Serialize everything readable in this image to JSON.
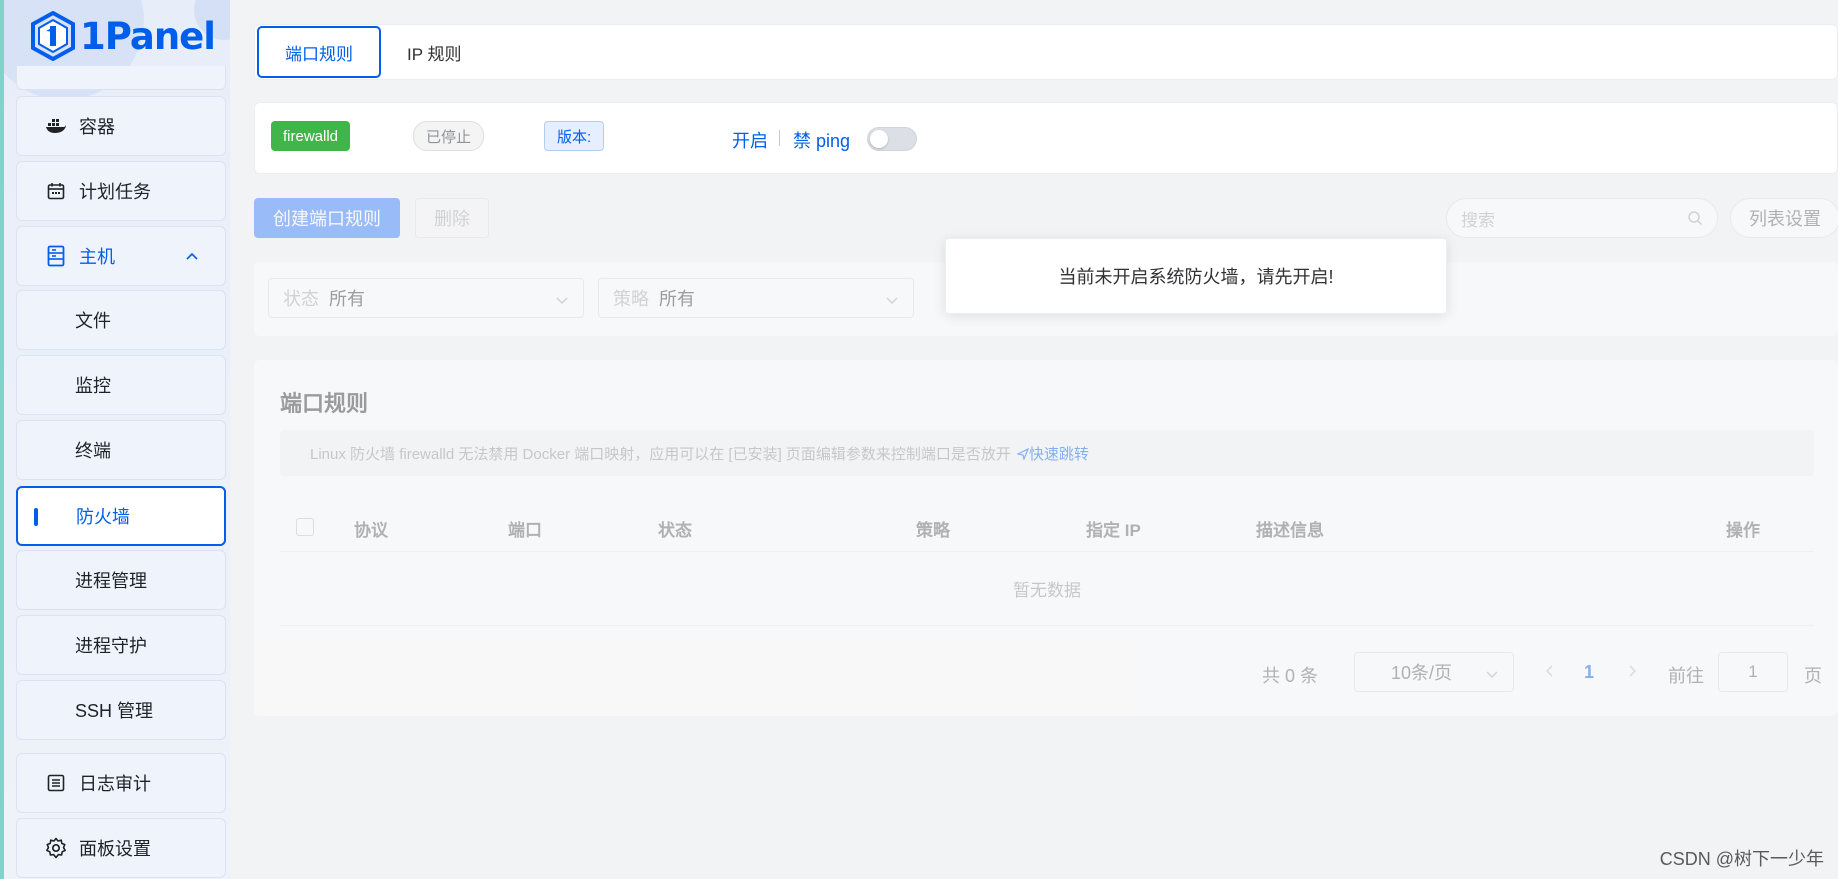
{
  "app": {
    "logo_text": "1Panel"
  },
  "sidebar": {
    "items": [
      {
        "label": "容器",
        "icon": "docker-icon"
      },
      {
        "label": "计划任务",
        "icon": "calendar-icon"
      },
      {
        "label": "主机",
        "icon": "host-icon",
        "expanded": true
      },
      {
        "label": "文件"
      },
      {
        "label": "监控"
      },
      {
        "label": "终端"
      },
      {
        "label": "防火墙",
        "active": true
      },
      {
        "label": "进程管理"
      },
      {
        "label": "进程守护"
      },
      {
        "label": "SSH 管理"
      },
      {
        "label": "日志审计",
        "icon": "list-icon"
      },
      {
        "label": "面板设置",
        "icon": "gear-icon"
      }
    ]
  },
  "tabs": [
    {
      "label": "端口规则",
      "active": true
    },
    {
      "label": "IP 规则"
    }
  ],
  "status": {
    "service_tag": "firewalld",
    "state_tag": "已停止",
    "version_tag": "版本:",
    "start_link": "开启",
    "ping_link": "禁 ping",
    "ping_disabled": false
  },
  "toolbar": {
    "create_label": "创建端口规则",
    "delete_label": "删除",
    "search_placeholder": "搜索",
    "list_settings_label": "列表设置"
  },
  "filters": {
    "status_label": "状态",
    "status_value": "所有",
    "strategy_label": "策略",
    "strategy_value": "所有"
  },
  "table": {
    "title": "端口规则",
    "alert_text": "Linux 防火墙 firewalld 无法禁用 Docker 端口映射，应用可以在 [已安装] 页面编辑参数来控制端口是否放开",
    "alert_link": "快速跳转",
    "columns": [
      "协议",
      "端口",
      "状态",
      "策略",
      "指定 IP",
      "描述信息",
      "操作"
    ],
    "empty_text": "暂无数据"
  },
  "pagination": {
    "total": "共 0 条",
    "page_size": "10条/页",
    "current_page": "1",
    "goto_label": "前往",
    "goto_value": "1",
    "goto_suffix": "页"
  },
  "toast": {
    "message": "当前未开启系统防火墙，请先开启!"
  },
  "watermark": "CSDN @树下一少年",
  "colors": {
    "accent": "#005eeb",
    "success": "#3fb54a"
  }
}
